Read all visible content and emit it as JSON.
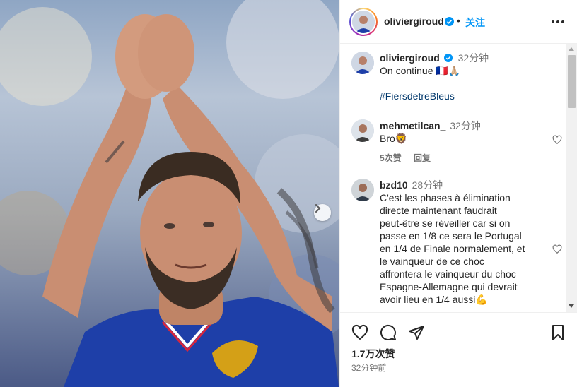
{
  "post": {
    "author": "oliviergiroud",
    "follow_label": "关注",
    "separator": "•",
    "caption_time": "32分钟",
    "caption_line1": "On continue 🇫🇷🙏🏼",
    "hashtag": "#FiersdetreBleus",
    "likes": "1.7万次赞",
    "posted": "32分钟前"
  },
  "comments": [
    {
      "username": "mehmetilcan_",
      "time": "32分钟",
      "text": "Bro🦁",
      "likes_label": "5次赞",
      "reply_label": "回复"
    },
    {
      "username": "bzd10",
      "time": "28分钟",
      "lines": [
        "C'est les phases à élimination",
        "directe maintenant faudrait",
        "peut-être se réveiller car si on",
        "passe en 1/8 ce sera le Portugal",
        "en 1/4 de Finale normalement, et",
        "le vainqueur de ce choc",
        "affrontera le vainqueur du choc",
        "Espagne-Allemagne qui devrait",
        "avoir lieu en 1/4 aussi💪"
      ]
    }
  ],
  "icons": {
    "verified": "verified-badge-icon",
    "more": "more-options-icon",
    "like": "heart-icon",
    "comment": "comment-icon",
    "share": "share-icon",
    "save": "bookmark-icon",
    "next": "chevron-right-icon"
  },
  "colors": {
    "accent": "#0095f6",
    "verified": "#0095f6",
    "text": "#262626",
    "muted": "#737373",
    "hashtag": "#00376b",
    "jersey": "#1e3fa8"
  }
}
